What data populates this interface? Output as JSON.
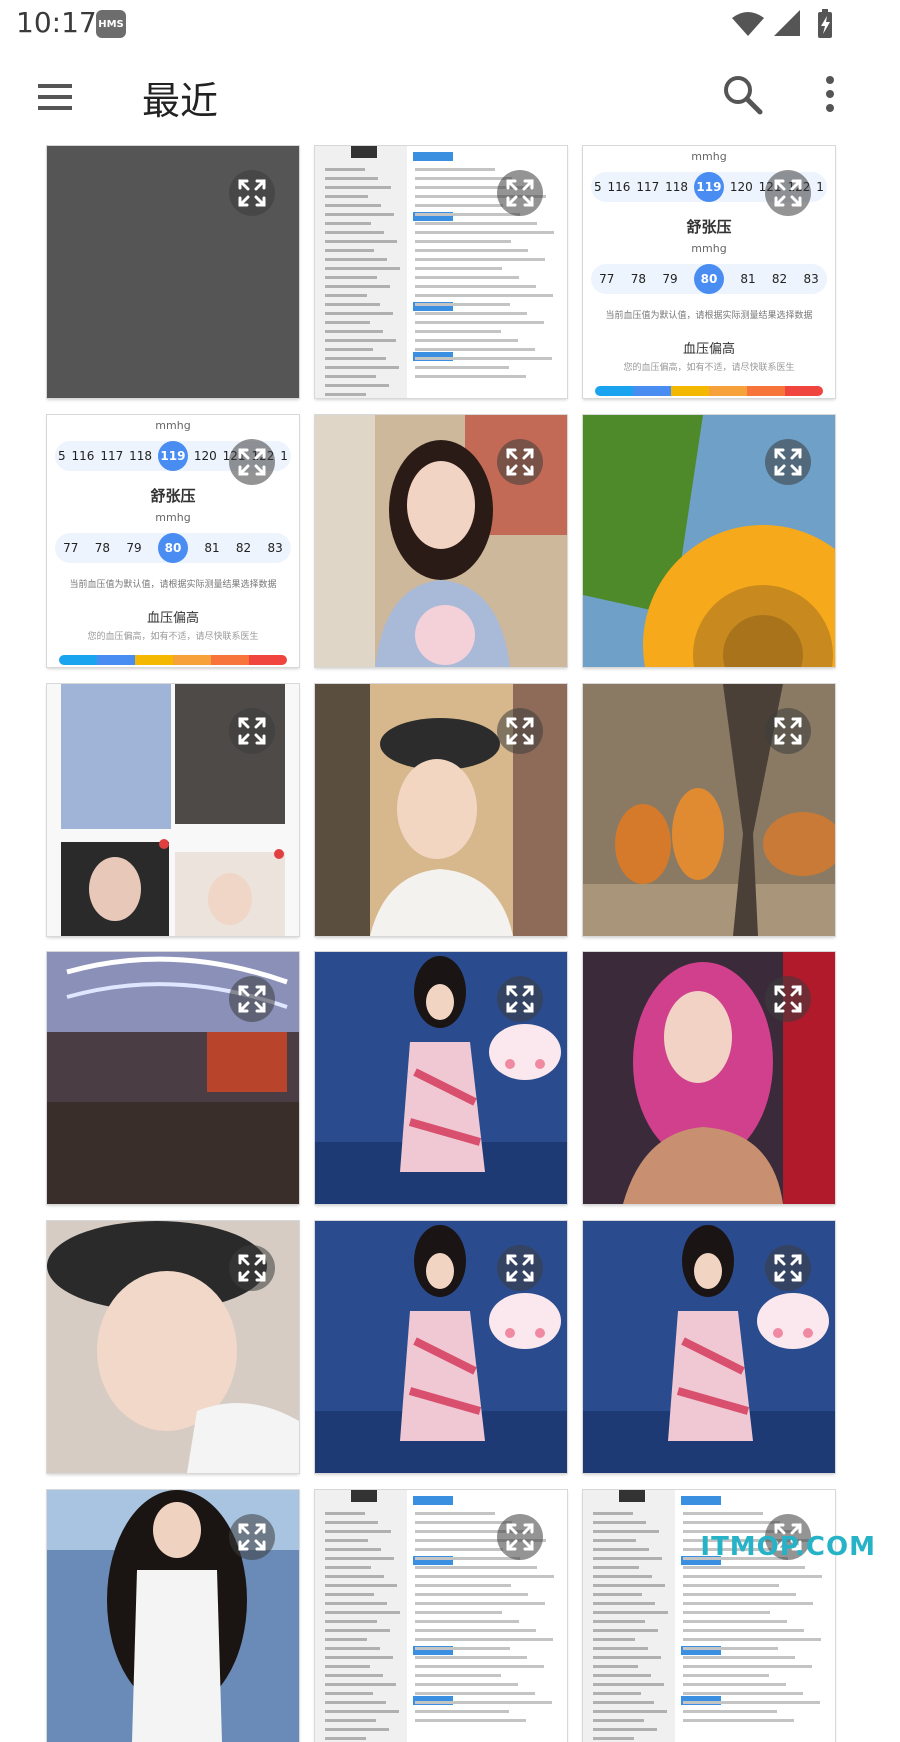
{
  "status": {
    "time": "10:17",
    "badge": "HMS"
  },
  "header": {
    "title": "最近"
  },
  "bp": {
    "unit": "mmhg",
    "systolic_values": [
      "5",
      "116",
      "117",
      "118",
      "119",
      "120",
      "121",
      "122",
      "1"
    ],
    "systolic_selected": "119",
    "diastolic_title": "舒张压",
    "diastolic_values": [
      "77",
      "78",
      "79",
      "80",
      "81",
      "82",
      "83"
    ],
    "diastolic_selected": "80",
    "hint": "当前血压值为默认值，请根据实际测量结果选择数据",
    "result_title": "血压偏高",
    "result_desc": "您的血压偏高，如有不适，请尽快联系医生",
    "scale_colors": [
      "#1aa4f0",
      "#4a8df2",
      "#f5b800",
      "#f6a13a",
      "#f7743a",
      "#f0453e"
    ]
  },
  "tiles": [
    {
      "kind": "gray"
    },
    {
      "kind": "resume"
    },
    {
      "kind": "bp"
    },
    {
      "kind": "bp"
    },
    {
      "kind": "portrait"
    },
    {
      "kind": "sunflower"
    },
    {
      "kind": "collage"
    },
    {
      "kind": "beret-app"
    },
    {
      "kind": "tigers"
    },
    {
      "kind": "city"
    },
    {
      "kind": "ocean"
    },
    {
      "kind": "pinkhair"
    },
    {
      "kind": "beret"
    },
    {
      "kind": "ocean"
    },
    {
      "kind": "ocean"
    },
    {
      "kind": "girl"
    },
    {
      "kind": "resume"
    },
    {
      "kind": "resume"
    }
  ],
  "watermark": "ITMOP.COM"
}
